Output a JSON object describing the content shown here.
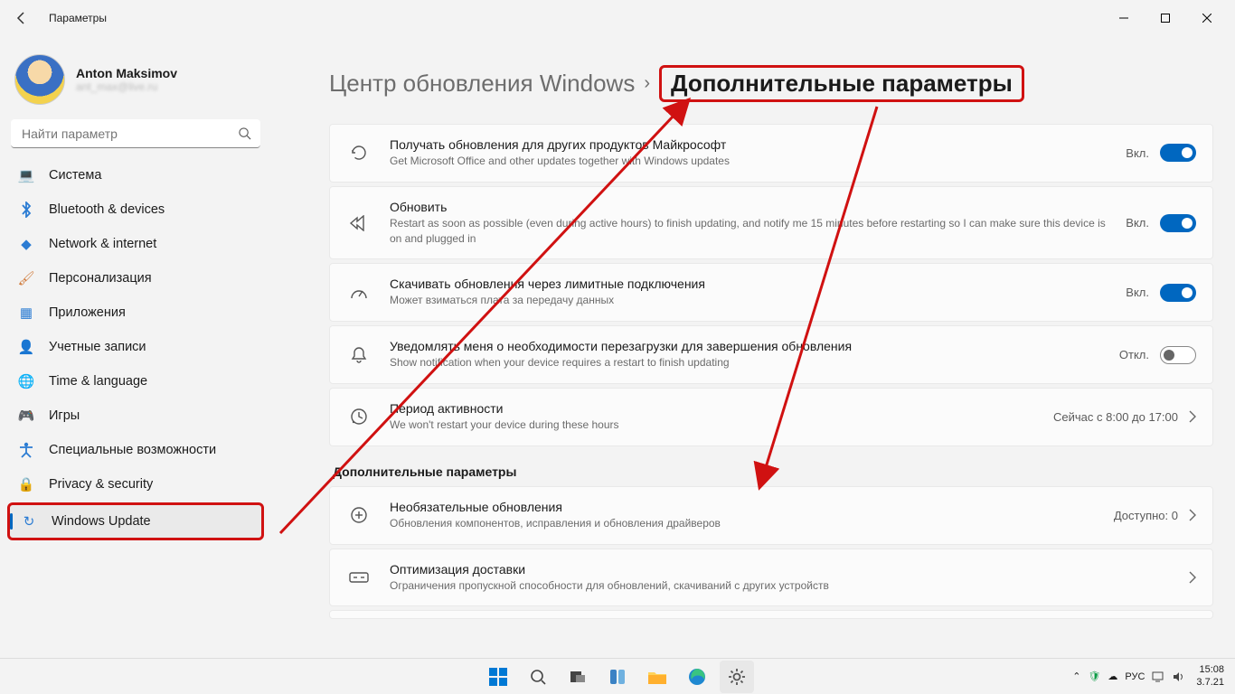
{
  "window": {
    "title": "Параметры"
  },
  "profile": {
    "name": "Anton Maksimov",
    "email": "ant_max@live.ru"
  },
  "search": {
    "placeholder": "Найти параметр"
  },
  "nav": [
    {
      "icon": "💻",
      "label": "Система",
      "color": "#2b7cd3"
    },
    {
      "icon": "B",
      "label": "Bluetooth & devices",
      "color": "#2b7cd3",
      "iconStyle": "bt"
    },
    {
      "icon": "◆",
      "label": "Network & internet",
      "color": "#2b7cd3"
    },
    {
      "icon": "🖌",
      "label": "Персонализация",
      "color": "#d07a3a"
    },
    {
      "icon": "▦",
      "label": "Приложения",
      "color": "#2b7cd3"
    },
    {
      "icon": "👤",
      "label": "Учетные записи",
      "color": "#2fa34f"
    },
    {
      "icon": "🌐",
      "label": "Time & language",
      "color": "#2b7cd3"
    },
    {
      "icon": "🎮",
      "label": "Игры",
      "color": "#888"
    },
    {
      "icon": "✖",
      "label": "Специальные возможности",
      "color": "#2b7cd3",
      "iconStyle": "acc"
    },
    {
      "icon": "🔒",
      "label": "Privacy & security",
      "color": "#888"
    },
    {
      "icon": "↻",
      "label": "Windows Update",
      "color": "#2b7cd3",
      "active": true
    }
  ],
  "breadcrumb": {
    "parent": "Центр обновления Windows",
    "current": "Дополнительные параметры"
  },
  "cards": [
    {
      "icon": "history",
      "title": "Получать обновления для других продуктов Майкрософт",
      "sub": "Get Microsoft Office and other updates together with Windows updates",
      "right": {
        "type": "toggle",
        "state": "Вкл.",
        "on": true
      }
    },
    {
      "icon": "fast",
      "title": "Обновить",
      "sub": "Restart as soon as possible (even during active hours) to finish updating, and notify me 15 minutes before restarting so I can make sure this device is on and plugged in",
      "right": {
        "type": "toggle",
        "state": "Вкл.",
        "on": true
      }
    },
    {
      "icon": "meter",
      "title": "Скачивать обновления через лимитные подключения",
      "sub": "Может взиматься плата за передачу данных",
      "right": {
        "type": "toggle",
        "state": "Вкл.",
        "on": true
      }
    },
    {
      "icon": "bell",
      "title": "Уведомлять меня о необходимости перезагрузки для завершения обновления",
      "sub": "Show notification when your device requires a restart to finish updating",
      "right": {
        "type": "toggle",
        "state": "Откл.",
        "on": false
      }
    },
    {
      "icon": "clock",
      "title": "Период активности",
      "sub": "We won't restart your device during these hours",
      "right": {
        "type": "link",
        "text": "Сейчас с 8:00 до 17:00"
      }
    }
  ],
  "section2": {
    "header": "Дополнительные параметры"
  },
  "cards2": [
    {
      "icon": "plus",
      "title": "Необязательные обновления",
      "sub": "Обновления компонентов, исправления и обновления драйверов",
      "right": {
        "type": "link",
        "text": "Доступно: 0"
      },
      "highlight": true
    },
    {
      "icon": "delivery",
      "title": "Оптимизация доставки",
      "sub": "Ограничения пропускной способности для обновлений, скачиваний с других устройств",
      "right": {
        "type": "chev"
      }
    }
  ],
  "taskbar": {
    "tray": {
      "chevron": "⌃",
      "shield": "🛡",
      "cloud": "☁",
      "lang": "РУС",
      "time": "15:08",
      "date": "3.7.21"
    }
  }
}
